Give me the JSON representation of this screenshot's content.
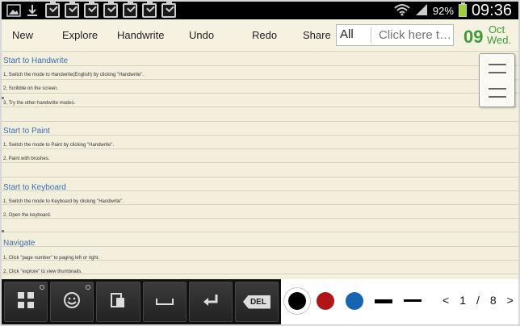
{
  "status_bar": {
    "battery": "92%",
    "time": "09:36"
  },
  "toolbar": {
    "new_label": "New",
    "explore_label": "Explore",
    "handwrite_label": "Handwrite",
    "undo_label": "Undo",
    "redo_label": "Redo",
    "share_label": "Share",
    "tag_selected": "All",
    "search_placeholder": "Click here t…",
    "date": {
      "day": "09",
      "month": "Oct",
      "weekday": "Wed."
    }
  },
  "note": {
    "sections": [
      {
        "heading": "Start to Handwrite",
        "lines": [
          "1, Switch the mode to Handwrite(English) by clicking \"Handwrite\".",
          "2, Scribble on the screen.",
          "3, Try the other handwrite modes."
        ]
      },
      {
        "heading": "Start to Paint",
        "lines": [
          "1, Switch the mode to Paint by clicking \"Handwrite\".",
          "2, Paint with brushes."
        ]
      },
      {
        "heading": "Start to Keyboard",
        "lines": [
          "1, Switch the mode to Keyboard by clicking \"Handwrite\".",
          "2, Open the keyboard."
        ]
      },
      {
        "heading": "Navigate",
        "lines": [
          "1, Click \"page number\" to paging left or right.",
          "2, Click \"explore\" to view thumbnails."
        ]
      }
    ]
  },
  "keybar": {
    "keys": [
      "grid-icon",
      "smiley-icon",
      "paste-icon",
      "space-icon",
      "enter-icon",
      "DEL"
    ]
  },
  "palette": {
    "colors": [
      "#000000",
      "#b01616",
      "#1565b3"
    ],
    "selected_color": "#000000"
  },
  "pager": {
    "prev": "<",
    "current": "1",
    "separator": "/",
    "total": "8",
    "next": ">"
  }
}
